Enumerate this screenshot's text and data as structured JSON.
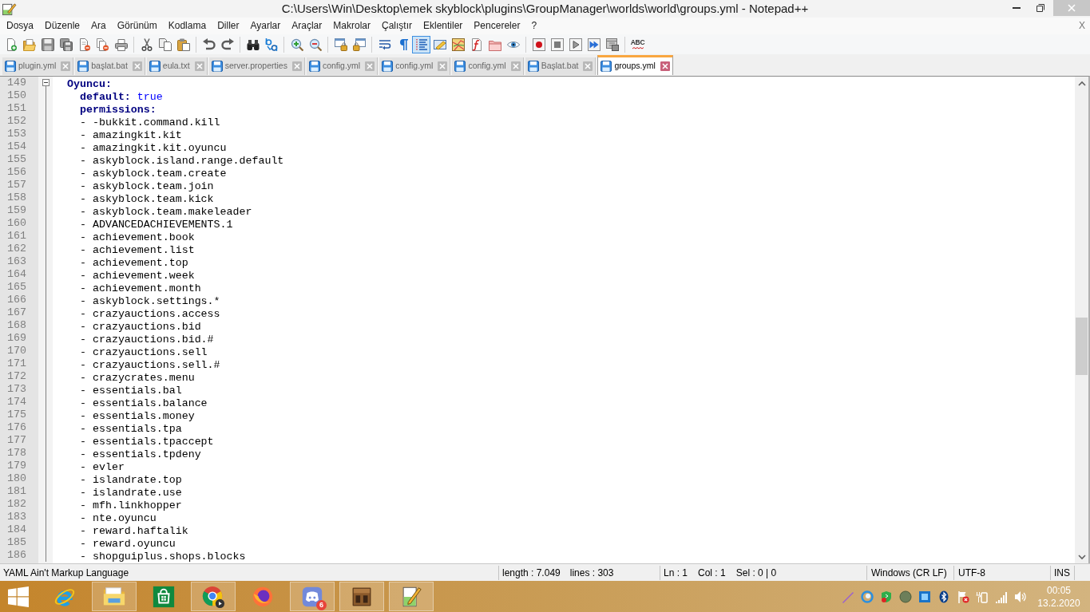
{
  "window": {
    "title": "C:\\Users\\Win\\Desktop\\emek skyblock\\plugins\\GroupManager\\worlds\\world\\groups.yml - Notepad++"
  },
  "menu": {
    "items": [
      "Dosya",
      "Düzenle",
      "Ara",
      "Görünüm",
      "Kodlama",
      "Diller",
      "Ayarlar",
      "Araçlar",
      "Makrolar",
      "Çalıştır",
      "Eklentiler",
      "Pencereler",
      "?"
    ],
    "close_label": "X"
  },
  "toolbar": {
    "groups": [
      [
        {
          "kind": "new",
          "pressed": false
        },
        {
          "kind": "open",
          "pressed": false
        },
        {
          "kind": "save",
          "pressed": false
        },
        {
          "kind": "saveall",
          "pressed": false
        },
        {
          "kind": "close",
          "pressed": false
        },
        {
          "kind": "closeall",
          "pressed": false
        },
        {
          "kind": "print",
          "pressed": false
        }
      ],
      [
        {
          "kind": "cut",
          "pressed": false
        },
        {
          "kind": "copy",
          "pressed": false
        },
        {
          "kind": "paste",
          "pressed": false
        }
      ],
      [
        {
          "kind": "undo",
          "pressed": false
        },
        {
          "kind": "redo",
          "pressed": false
        }
      ],
      [
        {
          "kind": "find",
          "pressed": false
        },
        {
          "kind": "replace",
          "pressed": false
        }
      ],
      [
        {
          "kind": "zoomin",
          "pressed": false
        },
        {
          "kind": "zoomout",
          "pressed": false
        }
      ],
      [
        {
          "kind": "syncv",
          "pressed": false
        },
        {
          "kind": "synch",
          "pressed": false
        }
      ],
      [
        {
          "kind": "wrap",
          "pressed": false
        },
        {
          "kind": "allchars",
          "pressed": false
        },
        {
          "kind": "indent",
          "pressed": true
        },
        {
          "kind": "userlang",
          "pressed": false
        },
        {
          "kind": "docmap",
          "pressed": false
        },
        {
          "kind": "funclist",
          "pressed": false
        },
        {
          "kind": "folder",
          "pressed": false
        },
        {
          "kind": "monitor",
          "pressed": false
        }
      ],
      [
        {
          "kind": "record",
          "pressed": false
        },
        {
          "kind": "stop",
          "pressed": false
        },
        {
          "kind": "play",
          "pressed": false
        },
        {
          "kind": "playmulti",
          "pressed": false
        },
        {
          "kind": "savemacro",
          "pressed": false
        }
      ],
      [
        {
          "kind": "spell",
          "label": "ABC"
        }
      ]
    ]
  },
  "tabs": [
    {
      "label": "plugin.yml",
      "selected": false
    },
    {
      "label": "başlat.bat",
      "selected": false
    },
    {
      "label": "eula.txt",
      "selected": false
    },
    {
      "label": "server.properties",
      "selected": false
    },
    {
      "label": "config.yml",
      "selected": false
    },
    {
      "label": "config.yml",
      "selected": false
    },
    {
      "label": "config.yml",
      "selected": false
    },
    {
      "label": "Başlat.bat",
      "selected": false
    },
    {
      "label": "groups.yml",
      "selected": true
    }
  ],
  "editor": {
    "lines": [
      {
        "number": "149",
        "kind": "key",
        "key": "Oyuncu:",
        "expanded": true,
        "children": [
          {
            "number": "150",
            "kind": "pair",
            "key": "default:",
            "value": "true"
          },
          {
            "number": "151",
            "kind": "key",
            "key": "permissions:"
          },
          {
            "number": "152",
            "kind": "item",
            "text": "- -bukkit.command.kill"
          },
          {
            "number": "153",
            "kind": "item",
            "text": "- amazingkit.kit"
          },
          {
            "number": "154",
            "kind": "item",
            "text": "- amazingkit.kit.oyuncu"
          },
          {
            "number": "155",
            "kind": "item",
            "text": "- askyblock.island.range.default"
          },
          {
            "number": "156",
            "kind": "item",
            "text": "- askyblock.team.create"
          },
          {
            "number": "157",
            "kind": "item",
            "text": "- askyblock.team.join"
          },
          {
            "number": "158",
            "kind": "item",
            "text": "- askyblock.team.kick"
          },
          {
            "number": "159",
            "kind": "item",
            "text": "- askyblock.team.makeleader"
          },
          {
            "number": "160",
            "kind": "item",
            "text": "- ADVANCEDACHIEVEMENTS.1"
          },
          {
            "number": "161",
            "kind": "item",
            "text": "- achievement.book"
          },
          {
            "number": "162",
            "kind": "item",
            "text": "- achievement.list"
          },
          {
            "number": "163",
            "kind": "item",
            "text": "- achievement.top"
          },
          {
            "number": "164",
            "kind": "item",
            "text": "- achievement.week"
          },
          {
            "number": "165",
            "kind": "item",
            "text": "- achievement.month"
          },
          {
            "number": "166",
            "kind": "item",
            "text": "- askyblock.settings.*"
          },
          {
            "number": "167",
            "kind": "item",
            "text": "- crazyauctions.access"
          },
          {
            "number": "168",
            "kind": "item",
            "text": "- crazyauctions.bid"
          },
          {
            "number": "169",
            "kind": "item",
            "text": "- crazyauctions.bid.#"
          },
          {
            "number": "170",
            "kind": "item",
            "text": "- crazyauctions.sell"
          },
          {
            "number": "171",
            "kind": "item",
            "text": "- crazyauctions.sell.#"
          },
          {
            "number": "172",
            "kind": "item",
            "text": "- crazycrates.menu"
          },
          {
            "number": "173",
            "kind": "item",
            "text": "- essentials.bal"
          },
          {
            "number": "174",
            "kind": "item",
            "text": "- essentials.balance"
          },
          {
            "number": "175",
            "kind": "item",
            "text": "- essentials.money"
          },
          {
            "number": "176",
            "kind": "item",
            "text": "- essentials.tpa"
          },
          {
            "number": "177",
            "kind": "item",
            "text": "- essentials.tpaccept"
          },
          {
            "number": "178",
            "kind": "item",
            "text": "- essentials.tpdeny"
          },
          {
            "number": "179",
            "kind": "item",
            "text": "- evler"
          },
          {
            "number": "180",
            "kind": "item",
            "text": "- islandrate.top"
          },
          {
            "number": "181",
            "kind": "item",
            "text": "- islandrate.use"
          },
          {
            "number": "182",
            "kind": "item",
            "text": "- mfh.linkhopper"
          },
          {
            "number": "183",
            "kind": "item",
            "text": "- nte.oyuncu"
          },
          {
            "number": "184",
            "kind": "item",
            "text": "- reward.haftalik"
          },
          {
            "number": "185",
            "kind": "item",
            "text": "- reward.oyuncu"
          },
          {
            "number": "186",
            "kind": "item",
            "text": "- shopguiplus.shops.blocks"
          }
        ]
      }
    ]
  },
  "status_bar": {
    "language": "YAML Ain't Markup Language",
    "length": "length : 7.049",
    "lines": "lines : 303",
    "line": "Ln : 1",
    "column": "Col : 1",
    "selection": "Sel : 0 | 0",
    "eol": "Windows (CR LF)",
    "encoding": "UTF-8",
    "mode": "INS"
  },
  "taskbar": {
    "apps": [
      {
        "kind": "ie",
        "running": false
      },
      {
        "kind": "explorer",
        "running": true
      },
      {
        "kind": "store",
        "running": false
      },
      {
        "kind": "chrome",
        "running": true
      },
      {
        "kind": "firefox",
        "running": false
      },
      {
        "kind": "discord",
        "running": true,
        "badge": "6"
      },
      {
        "kind": "minecraft",
        "running": true
      },
      {
        "kind": "notepad",
        "running": true
      }
    ],
    "clock": {
      "time": "00:05",
      "date": "13.2.2020"
    }
  }
}
